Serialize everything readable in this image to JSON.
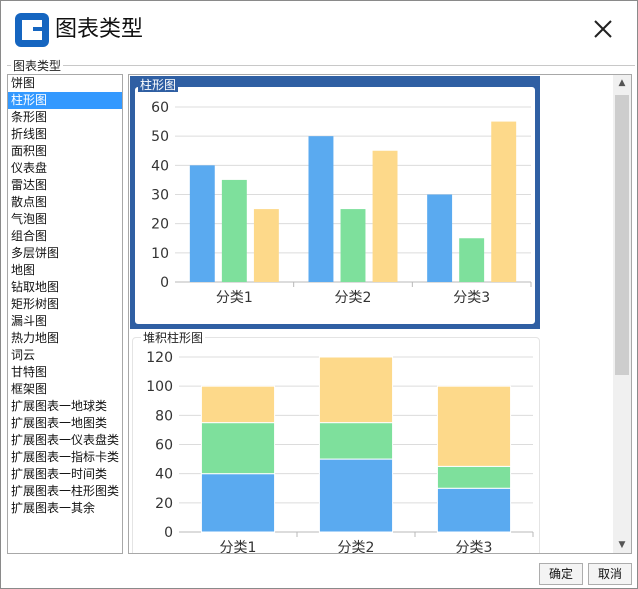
{
  "dialog": {
    "title": "图表类型",
    "logo_icon": "app-logo-icon",
    "close_icon": "close-icon"
  },
  "group": {
    "label": "图表类型"
  },
  "chart_types": [
    "饼图",
    "柱形图",
    "条形图",
    "折线图",
    "面积图",
    "仪表盘",
    "雷达图",
    "散点图",
    "气泡图",
    "组合图",
    "多层饼图",
    "地图",
    "钻取地图",
    "矩形树图",
    "漏斗图",
    "热力地图",
    "词云",
    "甘特图",
    "框架图",
    "扩展图表一地球类",
    "扩展图表一地图类",
    "扩展图表一仪表盘类",
    "扩展图表一指标卡类",
    "扩展图表一时间类",
    "扩展图表一柱形图类",
    "扩展图表一其余"
  ],
  "selected_index": 1,
  "colors": {
    "selection": "#3399ff",
    "card_highlight": "#2f5fa3",
    "series_blue": "#5aaaf0",
    "series_green": "#7ee09c",
    "series_orange": "#fdd98a"
  },
  "previews": {
    "first_title": "柱形图",
    "second_title": "堆积柱形图"
  },
  "chart_data": [
    {
      "type": "bar",
      "title": "柱形图",
      "categories": [
        "分类1",
        "分类2",
        "分类3"
      ],
      "series": [
        {
          "values": [
            40,
            50,
            30
          ],
          "color": "#5aaaf0"
        },
        {
          "values": [
            35,
            25,
            15
          ],
          "color": "#7ee09c"
        },
        {
          "values": [
            25,
            45,
            55
          ],
          "color": "#fdd98a"
        }
      ],
      "ylim": [
        0,
        60
      ],
      "yticks": [
        0,
        10,
        20,
        30,
        40,
        50,
        60
      ],
      "grid": true
    },
    {
      "type": "bar",
      "stacked": true,
      "title": "堆积柱形图",
      "categories": [
        "分类1",
        "分类2",
        "分类3"
      ],
      "series": [
        {
          "values": [
            40,
            50,
            30
          ],
          "color": "#5aaaf0"
        },
        {
          "values": [
            35,
            25,
            15
          ],
          "color": "#7ee09c"
        },
        {
          "values": [
            25,
            45,
            55
          ],
          "color": "#fdd98a"
        }
      ],
      "ylim": [
        0,
        120
      ],
      "yticks": [
        0,
        20,
        40,
        60,
        80,
        100,
        120
      ],
      "grid": true
    }
  ],
  "buttons": {
    "ok": "确定",
    "cancel": "取消"
  }
}
